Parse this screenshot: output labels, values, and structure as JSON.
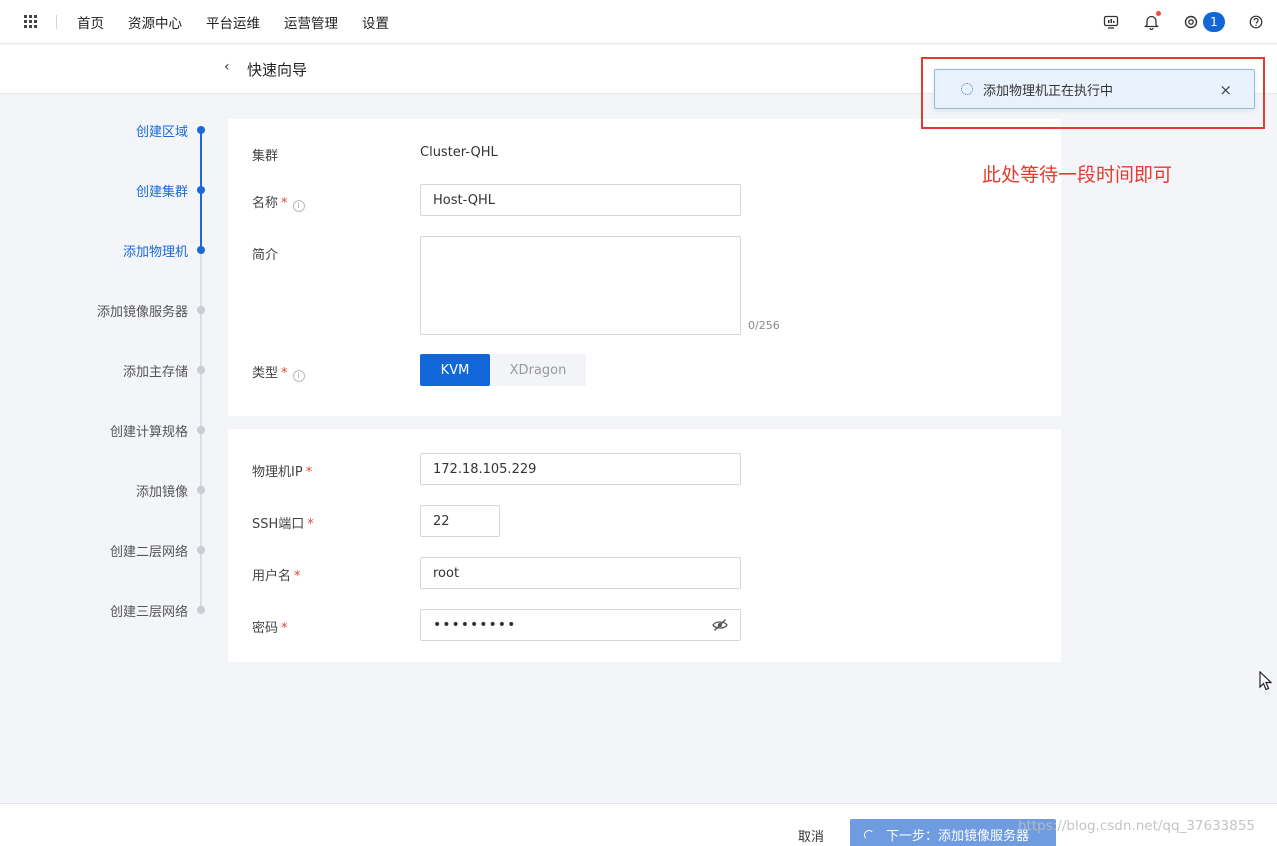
{
  "topbar": {
    "nav": [
      "首页",
      "资源中心",
      "平台运维",
      "运营管理",
      "设置"
    ],
    "task_count": "1"
  },
  "header": {
    "back_glyph": "‹",
    "title": "快速向导"
  },
  "steps": [
    {
      "label": "创建区域",
      "state": "done"
    },
    {
      "label": "创建集群",
      "state": "done"
    },
    {
      "label": "添加物理机",
      "state": "current"
    },
    {
      "label": "添加镜像服务器",
      "state": "todo"
    },
    {
      "label": "添加主存储",
      "state": "todo"
    },
    {
      "label": "创建计算规格",
      "state": "todo"
    },
    {
      "label": "添加镜像",
      "state": "todo"
    },
    {
      "label": "创建二层网络",
      "state": "todo"
    },
    {
      "label": "创建三层网络",
      "state": "todo"
    }
  ],
  "form": {
    "cluster_label": "集群",
    "cluster_value": "Cluster-QHL",
    "name_label": "名称",
    "name_value": "Host-QHL",
    "desc_label": "简介",
    "desc_counter": "0/256",
    "type_label": "类型",
    "type_options": [
      "KVM",
      "XDragon"
    ],
    "type_selected": "KVM",
    "ip_label": "物理机IP",
    "ip_value": "172.18.105.229",
    "ssh_label": "SSH端口",
    "ssh_value": "22",
    "user_label": "用户名",
    "user_value": "root",
    "pwd_label": "密码",
    "pwd_mask": "•••••••••",
    "required_mark": "*",
    "info_glyph": "i"
  },
  "footer": {
    "cancel": "取消",
    "next": "下一步：添加镜像服务器",
    "watermark": "https://blog.csdn.net/qq_37633855"
  },
  "toast": {
    "text": "添加物理机正在执行中",
    "close": "×"
  },
  "annotation": {
    "text": "此处等待一段时间即可",
    "color": "#e53a2f"
  },
  "colors": {
    "primary": "#1167d8",
    "active_step": "#1a6ad9",
    "next_button_loading": "#6f9be0"
  }
}
